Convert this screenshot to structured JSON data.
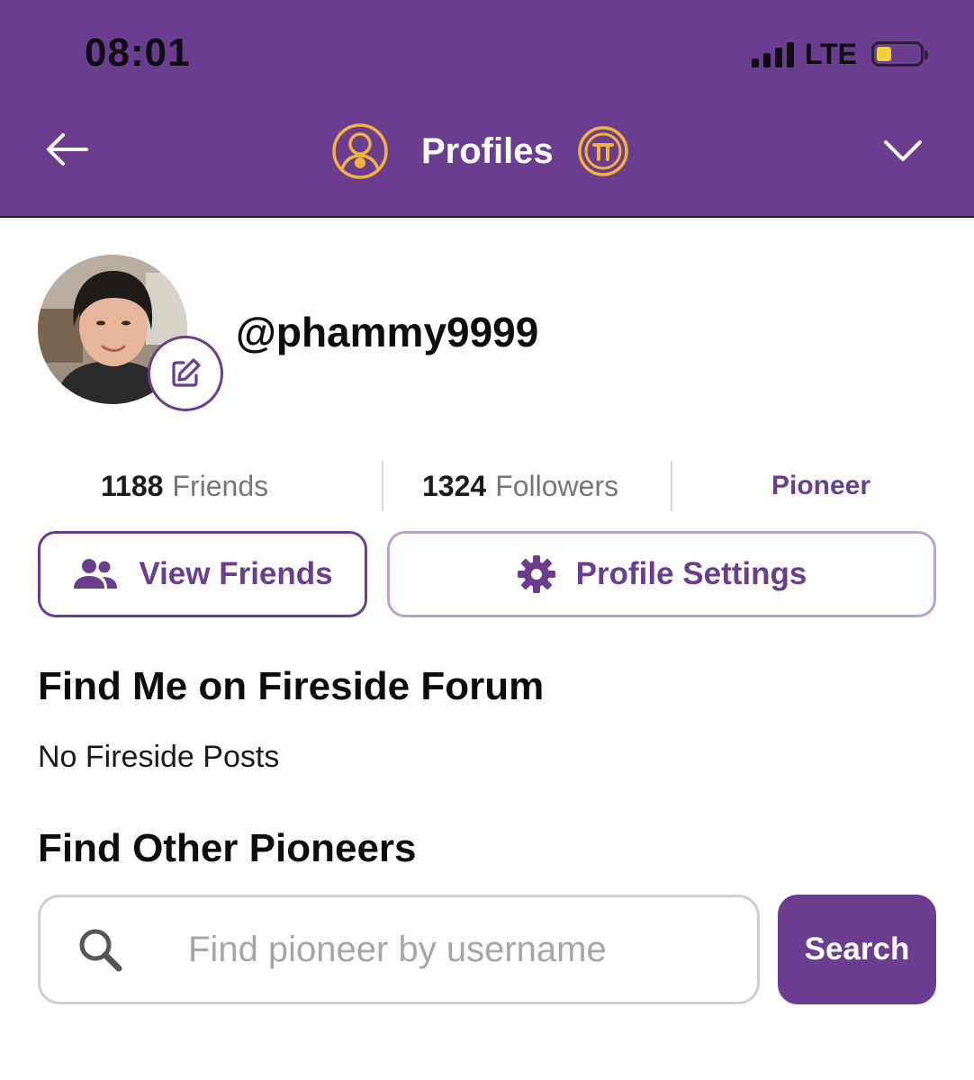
{
  "status_bar": {
    "time": "08:01",
    "network": "LTE",
    "battery_level": 0.35
  },
  "header": {
    "title": "Profiles",
    "back_icon": "arrow-left-icon",
    "menu_icon": "chevron-down-icon"
  },
  "profile": {
    "username": "@phammy9999",
    "avatar_icon": "user-photo",
    "edit_icon": "pencil-square-icon"
  },
  "stats": {
    "friends_count": "1188",
    "friends_label": "Friends",
    "followers_count": "1324",
    "followers_label": "Followers",
    "role": "Pioneer"
  },
  "actions": {
    "view_friends": "View Friends",
    "profile_settings": "Profile Settings"
  },
  "fireside": {
    "title": "Find Me on Fireside Forum",
    "empty_text": "No Fireside Posts"
  },
  "find_pioneers": {
    "title": "Find Other Pioneers",
    "placeholder": "Find pioneer by username",
    "value": "",
    "search_label": "Search"
  },
  "colors": {
    "brand_purple": "#6a3d8f",
    "accent_gold": "#f2b33d",
    "battery_yellow": "#f2cf3b"
  }
}
